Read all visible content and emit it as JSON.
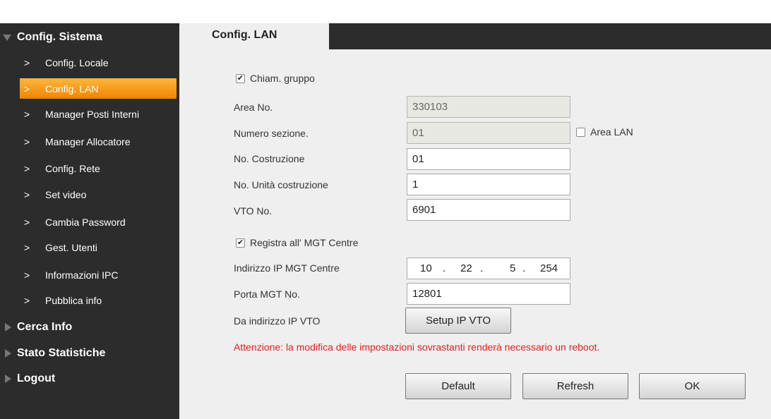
{
  "sidebar": {
    "section_system": "Config. Sistema",
    "items": [
      {
        "label": "Config. Locale"
      },
      {
        "label": "Config. LAN"
      },
      {
        "label": "Manager Posti Interni"
      },
      {
        "label": "Manager Allocatore"
      },
      {
        "label": "Config. Rete"
      },
      {
        "label": "Set video"
      },
      {
        "label": "Cambia Password"
      },
      {
        "label": "Gest. Utenti"
      },
      {
        "label": "Informazioni IPC"
      },
      {
        "label": "Pubblica info"
      }
    ],
    "section_search": "Cerca Info",
    "section_stats": "Stato Statistiche",
    "section_logout": "Logout",
    "chevron": ">"
  },
  "tab": {
    "label": "Config. LAN"
  },
  "form": {
    "group_call_label": "Chiam. gruppo",
    "area_no_label": "Area No.",
    "area_no_value": "330103",
    "section_no_label": "Numero sezione.",
    "section_no_value": "01",
    "area_lan_label": "Area LAN",
    "building_no_label": "No. Costruzione",
    "building_no_value": "01",
    "building_unit_label": "No. Unità costruzione",
    "building_unit_value": "1",
    "vto_no_label": "VTO No.",
    "vto_no_value": "6901",
    "register_mgt_label": "Registra all' MGT Centre",
    "mgt_ip_label": "Indirizzo IP MGT Centre",
    "mgt_ip": [
      "10",
      "22",
      "5",
      "254"
    ],
    "mgt_port_label": "Porta MGT No.",
    "mgt_port_value": "12801",
    "vto_ip_label": "Da indirizzo IP VTO",
    "setup_ip_button": "Setup IP VTO",
    "warning": "Attenzione: la modifica delle impostazioni sovrastanti renderà necessario un reboot."
  },
  "buttons": {
    "default": "Default",
    "refresh": "Refresh",
    "ok": "OK"
  },
  "colors": {
    "sidebar_bg": "#2c2c2c",
    "active_item": "#f59a16",
    "panel_bg": "#efefef",
    "warning": "#e02020"
  }
}
